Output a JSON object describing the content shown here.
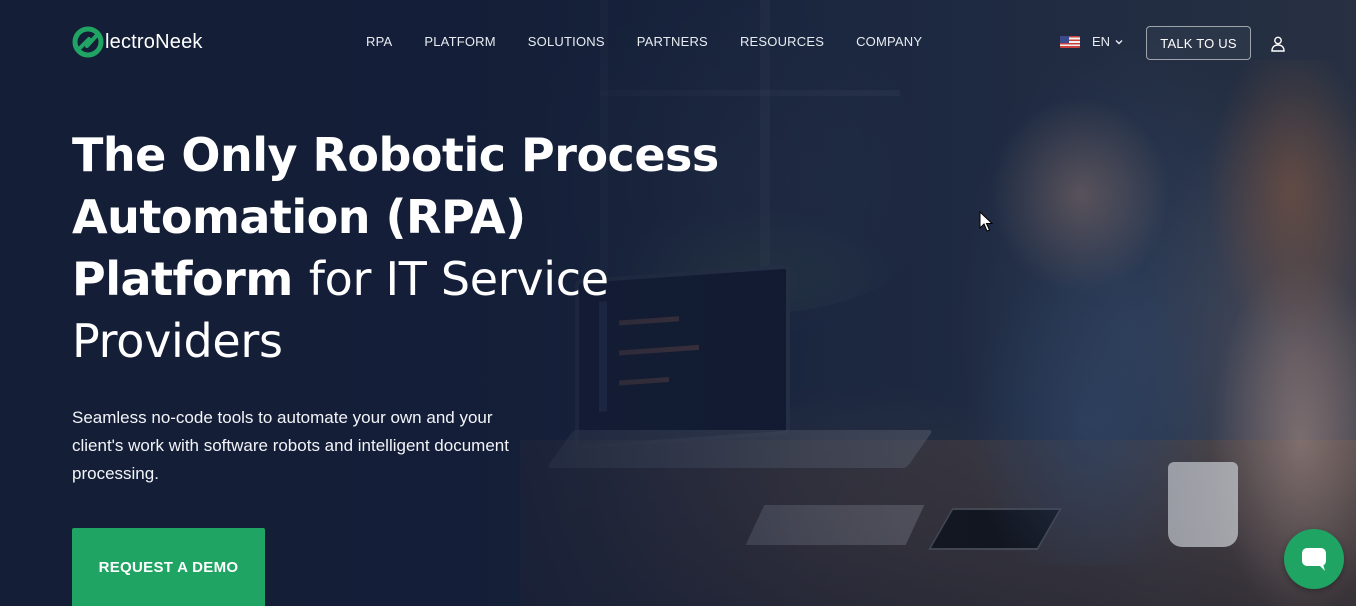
{
  "brand": {
    "name": "lectroNeek",
    "accent_color": "#1fa463"
  },
  "nav": {
    "items": [
      {
        "label": "RPA"
      },
      {
        "label": "PLATFORM"
      },
      {
        "label": "SOLUTIONS"
      },
      {
        "label": "PARTNERS"
      },
      {
        "label": "RESOURCES"
      },
      {
        "label": "COMPANY"
      }
    ]
  },
  "language": {
    "label": "EN",
    "flag_icon": "us-flag-icon"
  },
  "header_cta": {
    "label": "TALK TO US"
  },
  "hero": {
    "headline_bold_1": "The Only Robotic Process",
    "headline_bold_2": "Automation (RPA)",
    "headline_bold_3": "Platform",
    "headline_light_1": "for IT Service",
    "headline_light_2": "Providers",
    "subtext": "Seamless no-code tools to automate your own and your client's work with software robots and intelligent document processing.",
    "cta_label": "REQUEST A DEMO"
  },
  "icons": {
    "user": "user-icon",
    "chat": "chat-bubble-icon",
    "chevron": "chevron-down-icon"
  }
}
